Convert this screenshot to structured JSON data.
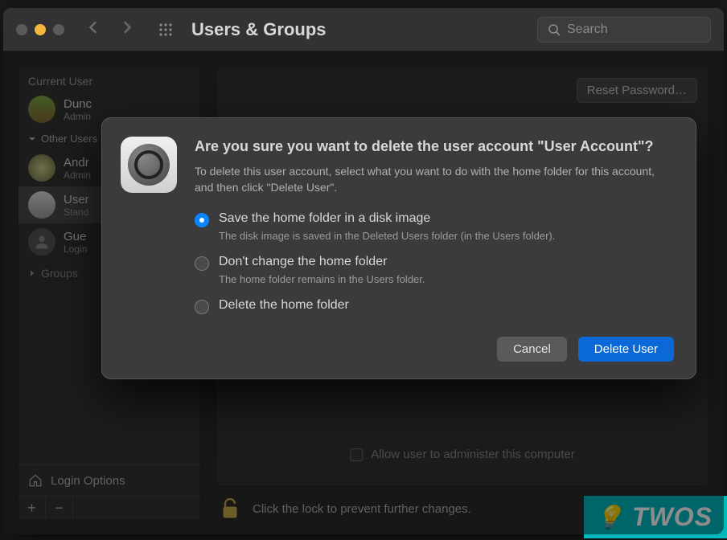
{
  "window": {
    "title": "Users & Groups",
    "search_placeholder": "Search"
  },
  "sidebar": {
    "current_user_header": "Current User",
    "other_header": "Other Users",
    "groups_label": "Groups",
    "login_options_label": "Login Options",
    "users": {
      "current": {
        "name": "Dunc",
        "role": "Admin"
      },
      "others": [
        {
          "name": "Andr",
          "role": "Admin"
        },
        {
          "name": "User",
          "role": "Stand"
        },
        {
          "name": "Gue",
          "role": "Login"
        }
      ]
    },
    "add": "+",
    "remove": "−"
  },
  "main": {
    "reset_password": "Reset Password…",
    "admin_checkbox": "Allow user to administer this computer"
  },
  "lock": {
    "text": "Click the lock to prevent further changes."
  },
  "dialog": {
    "title": "Are you sure you want to delete the user account \"User Account\"?",
    "description": "To delete this user account, select what you want to do with the home folder for this account, and then click \"Delete User\".",
    "options": [
      {
        "label": "Save the home folder in a disk image",
        "sub": "The disk image is saved in the Deleted Users folder (in the Users folder).",
        "checked": true
      },
      {
        "label": "Don't change the home folder",
        "sub": "The home folder remains in the Users folder.",
        "checked": false
      },
      {
        "label": "Delete the home folder",
        "sub": "",
        "checked": false
      }
    ],
    "cancel": "Cancel",
    "confirm": "Delete User"
  },
  "watermark": {
    "text": "TWOS"
  }
}
